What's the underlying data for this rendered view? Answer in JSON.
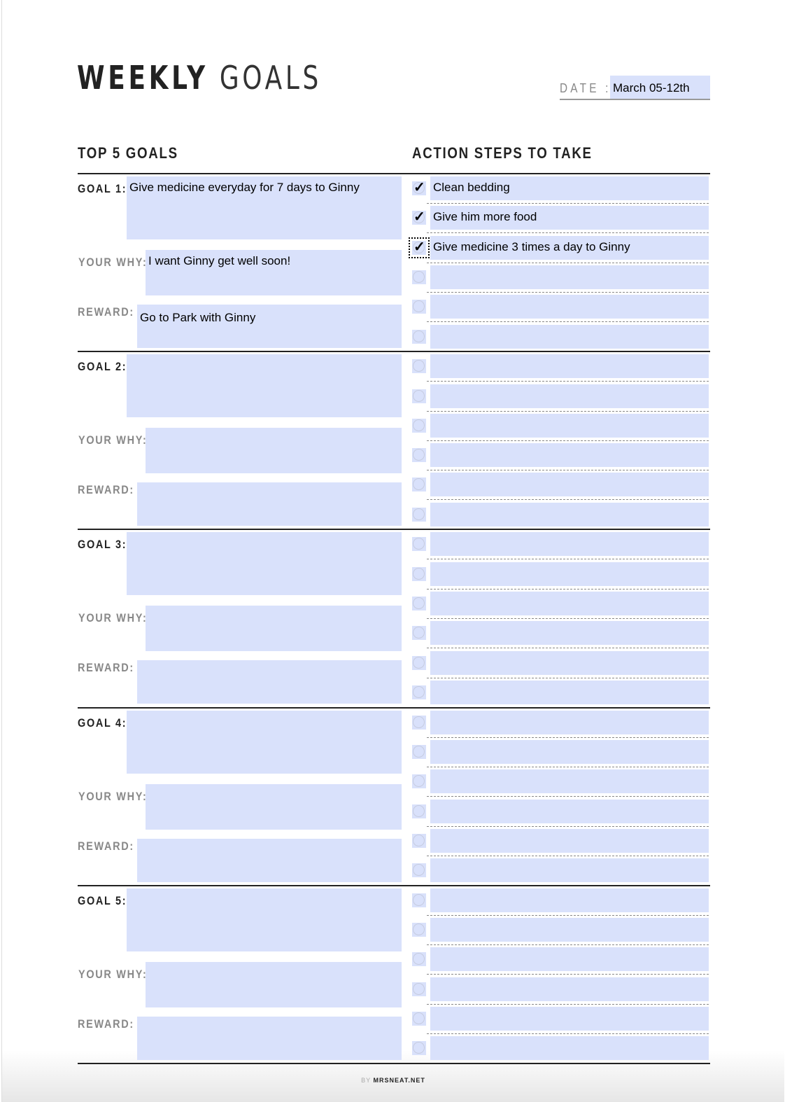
{
  "header": {
    "title_bold": "WEEKLY",
    "title_light": "GOALS",
    "date_label": "DATE :",
    "date_value": "March 05-12th"
  },
  "columns": {
    "left": "TOP 5 GOALS",
    "right": "ACTION STEPS TO TAKE"
  },
  "labels": {
    "why": "YOUR WHY:",
    "reward": "REWARD:"
  },
  "goals": [
    {
      "label": "GOAL 1:",
      "goal": "Give medicine everyday for 7 days to Ginny",
      "why": "I want Ginny get well soon!",
      "reward": "Go to Park with Ginny",
      "steps": [
        {
          "text": "Clean bedding",
          "checked": true
        },
        {
          "text": "Give him more food",
          "checked": true
        },
        {
          "text": "Give medicine 3 times a day to Ginny",
          "checked": true,
          "focused": true
        },
        {
          "text": "",
          "checked": false
        },
        {
          "text": "",
          "checked": false
        },
        {
          "text": "",
          "checked": false
        }
      ]
    },
    {
      "label": "GOAL 2:",
      "goal": "",
      "why": "",
      "reward": "",
      "steps": [
        {
          "text": "",
          "checked": false
        },
        {
          "text": "",
          "checked": false
        },
        {
          "text": "",
          "checked": false
        },
        {
          "text": "",
          "checked": false
        },
        {
          "text": "",
          "checked": false
        },
        {
          "text": "",
          "checked": false
        }
      ]
    },
    {
      "label": "GOAL 3:",
      "goal": "",
      "why": "",
      "reward": "",
      "steps": [
        {
          "text": "",
          "checked": false
        },
        {
          "text": "",
          "checked": false
        },
        {
          "text": "",
          "checked": false
        },
        {
          "text": "",
          "checked": false
        },
        {
          "text": "",
          "checked": false
        },
        {
          "text": "",
          "checked": false
        }
      ]
    },
    {
      "label": "GOAL 4:",
      "goal": "",
      "why": "",
      "reward": "",
      "steps": [
        {
          "text": "",
          "checked": false
        },
        {
          "text": "",
          "checked": false
        },
        {
          "text": "",
          "checked": false
        },
        {
          "text": "",
          "checked": false
        },
        {
          "text": "",
          "checked": false
        },
        {
          "text": "",
          "checked": false
        }
      ]
    },
    {
      "label": "GOAL 5:",
      "goal": "",
      "why": "",
      "reward": "",
      "steps": [
        {
          "text": "",
          "checked": false
        },
        {
          "text": "",
          "checked": false
        },
        {
          "text": "",
          "checked": false
        },
        {
          "text": "",
          "checked": false
        },
        {
          "text": "",
          "checked": false
        },
        {
          "text": "",
          "checked": false
        }
      ]
    }
  ],
  "footer": {
    "by": "BY",
    "site": "MRSNEAT.NET"
  },
  "colors": {
    "field": "#d9e1fb",
    "text": "#222222",
    "label_gray": "#888888"
  }
}
